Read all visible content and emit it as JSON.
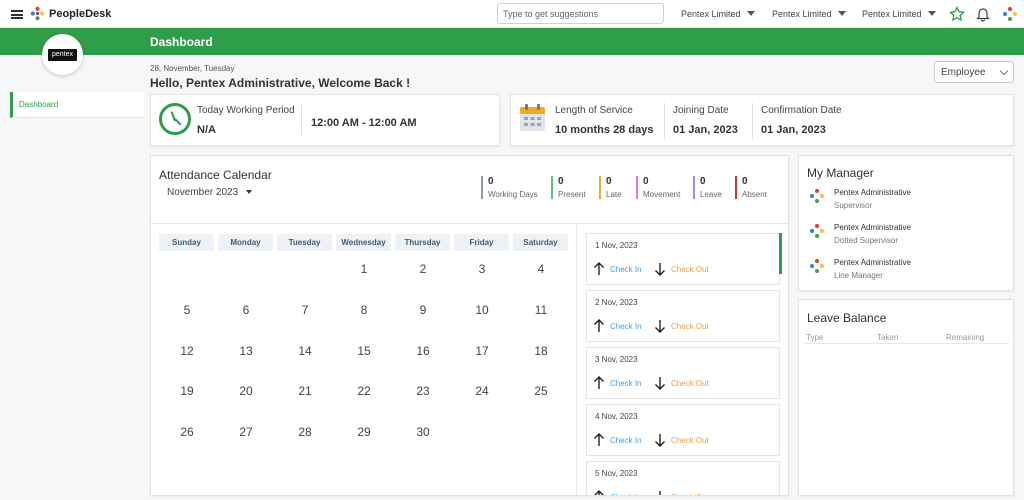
{
  "topbar": {
    "brand": "PeopleDesk",
    "search_placeholder": "Type to get suggestions",
    "org_selectors": [
      "Pentex Limited",
      "Pentex Limited",
      "Pentex Limited"
    ]
  },
  "header": {
    "title": "Dashboard"
  },
  "profile": {
    "avatar_text": "pentex"
  },
  "sidebar": {
    "items": [
      {
        "label": "Dashboard",
        "active": true
      }
    ]
  },
  "greeting": {
    "date": "28, November, Tuesday",
    "welcome": "Hello, Pentex Administrative, Welcome Back !"
  },
  "role_select": {
    "value": "Employee"
  },
  "working_period": {
    "label": "Today Working Period",
    "status": "N/A",
    "time": "12:00 AM - 12:00 AM"
  },
  "service": {
    "length_label": "Length of Service",
    "length_value": "10 months 28 days",
    "joining_label": "Joining Date",
    "joining_value": "01 Jan, 2023",
    "confirmation_label": "Confirmation Date",
    "confirmation_value": "01 Jan, 2023"
  },
  "attendance": {
    "title": "Attendance Calendar",
    "month": "November",
    "year": "2023",
    "stats": [
      {
        "count": "0",
        "label": "Working Days",
        "color": "#8a9bb0"
      },
      {
        "count": "0",
        "label": "Present",
        "color": "#5cc47a"
      },
      {
        "count": "0",
        "label": "Late",
        "color": "#f5a623"
      },
      {
        "count": "0",
        "label": "Movement",
        "color": "#d07de0"
      },
      {
        "count": "0",
        "label": "Leave",
        "color": "#9b87f5"
      },
      {
        "count": "0",
        "label": "Absent",
        "color": "#d32f2f"
      }
    ],
    "weekdays": [
      "Sunday",
      "Monday",
      "Tuesday",
      "Wednesday",
      "Thursday",
      "Friday",
      "Saturday"
    ],
    "days": [
      "1",
      "2",
      "3",
      "4",
      "5",
      "6",
      "7",
      "8",
      "9",
      "10",
      "11",
      "12",
      "13",
      "14",
      "15",
      "16",
      "17",
      "18",
      "19",
      "20",
      "21",
      "22",
      "23",
      "24",
      "25",
      "26",
      "27",
      "28",
      "29",
      "30"
    ],
    "daily": [
      {
        "date": "1 Nov, 2023",
        "check_in": "Check In",
        "check_out": "Check Out"
      },
      {
        "date": "2 Nov, 2023",
        "check_in": "Check In",
        "check_out": "Check Out"
      },
      {
        "date": "3 Nov, 2023",
        "check_in": "Check In",
        "check_out": "Check Out"
      },
      {
        "date": "4 Nov, 2023",
        "check_in": "Check In",
        "check_out": "Check Out"
      },
      {
        "date": "5 Nov, 2023",
        "check_in": "Check In",
        "check_out": "Check Out"
      }
    ]
  },
  "my_manager": {
    "title": "My Manager",
    "managers": [
      {
        "name": "Pentex Administrative",
        "role": "Supervisor"
      },
      {
        "name": "Pentex Administrative",
        "role": "Dotted Supervisor"
      },
      {
        "name": "Pentex Administrative",
        "role": "Line Manager"
      }
    ]
  },
  "leave_balance": {
    "title": "Leave Balance",
    "columns": [
      "Type",
      "Taken",
      "Remaining"
    ]
  },
  "colors": {
    "brand_green": "#2e9e48",
    "check_in": "#3aa0e8",
    "check_out": "#f2994a"
  }
}
